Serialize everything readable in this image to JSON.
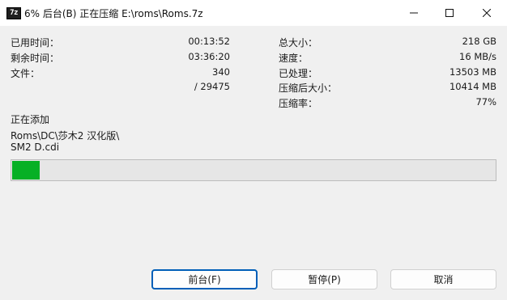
{
  "titlebar": {
    "icon_text": "7z",
    "title": "6% 后台(B) 正在压缩 E:\\roms\\Roms.7z"
  },
  "stats_left": [
    {
      "label": "已用时间：",
      "value": "00:13:52"
    },
    {
      "label": "剩余时间：",
      "value": "03:36:20"
    },
    {
      "label": "文件：",
      "value": "340"
    },
    {
      "label": "",
      "value": "/ 29475"
    }
  ],
  "stats_right": [
    {
      "label": "总大小：",
      "value": "218 GB"
    },
    {
      "label": "速度：",
      "value": "16 MB/s"
    },
    {
      "label": "已处理：",
      "value": "13503 MB"
    },
    {
      "label": "压缩后大小：",
      "value": "10414 MB"
    },
    {
      "label": "压缩率：",
      "value": "77%"
    }
  ],
  "status": {
    "action": "正在添加",
    "file_line1": "Roms\\DC\\莎木2 汉化版\\",
    "file_line2": "SM2 D.cdi"
  },
  "progress": {
    "percent": 6,
    "color": "#06b025"
  },
  "buttons": {
    "background": "前台(F)",
    "pause": "暂停(P)",
    "cancel": "取消"
  },
  "colors": {
    "accent": "#005fb8"
  }
}
